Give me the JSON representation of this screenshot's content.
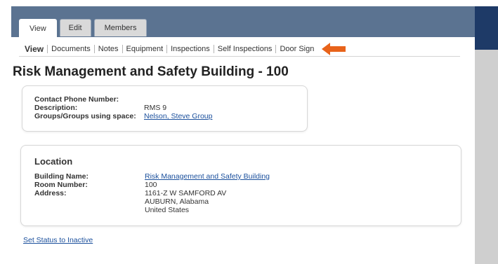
{
  "tabs": [
    {
      "label": "View"
    },
    {
      "label": "Edit"
    },
    {
      "label": "Members"
    }
  ],
  "subnav": {
    "items": [
      "View",
      "Documents",
      "Notes",
      "Equipment",
      "Inspections",
      "Self Inspections",
      "Door Sign"
    ],
    "arrow_color": "#e8631a"
  },
  "page_title": "Risk Management and Safety Building - 100",
  "details": {
    "contact_phone_label": "Contact Phone Number:",
    "contact_phone_value": "",
    "description_label": "Description:",
    "description_value": "RMS 9",
    "groups_label": "Groups/Groups using space:",
    "groups_value": "Nelson, Steve Group"
  },
  "location": {
    "title": "Location",
    "building_label": "Building Name:",
    "building_value": "Risk Management and Safety Building",
    "room_label": "Room Number:",
    "room_value": "100",
    "address_label": "Address:",
    "address_line1": "1161-Z W SAMFORD AV",
    "address_line2": "AUBURN, Alabama",
    "address_line3": "United States"
  },
  "status_link": "Set Status to Inactive",
  "colors": {
    "header_band": "#5b7391",
    "header_dark": "#1e3a67",
    "link": "#1a4f9c"
  }
}
